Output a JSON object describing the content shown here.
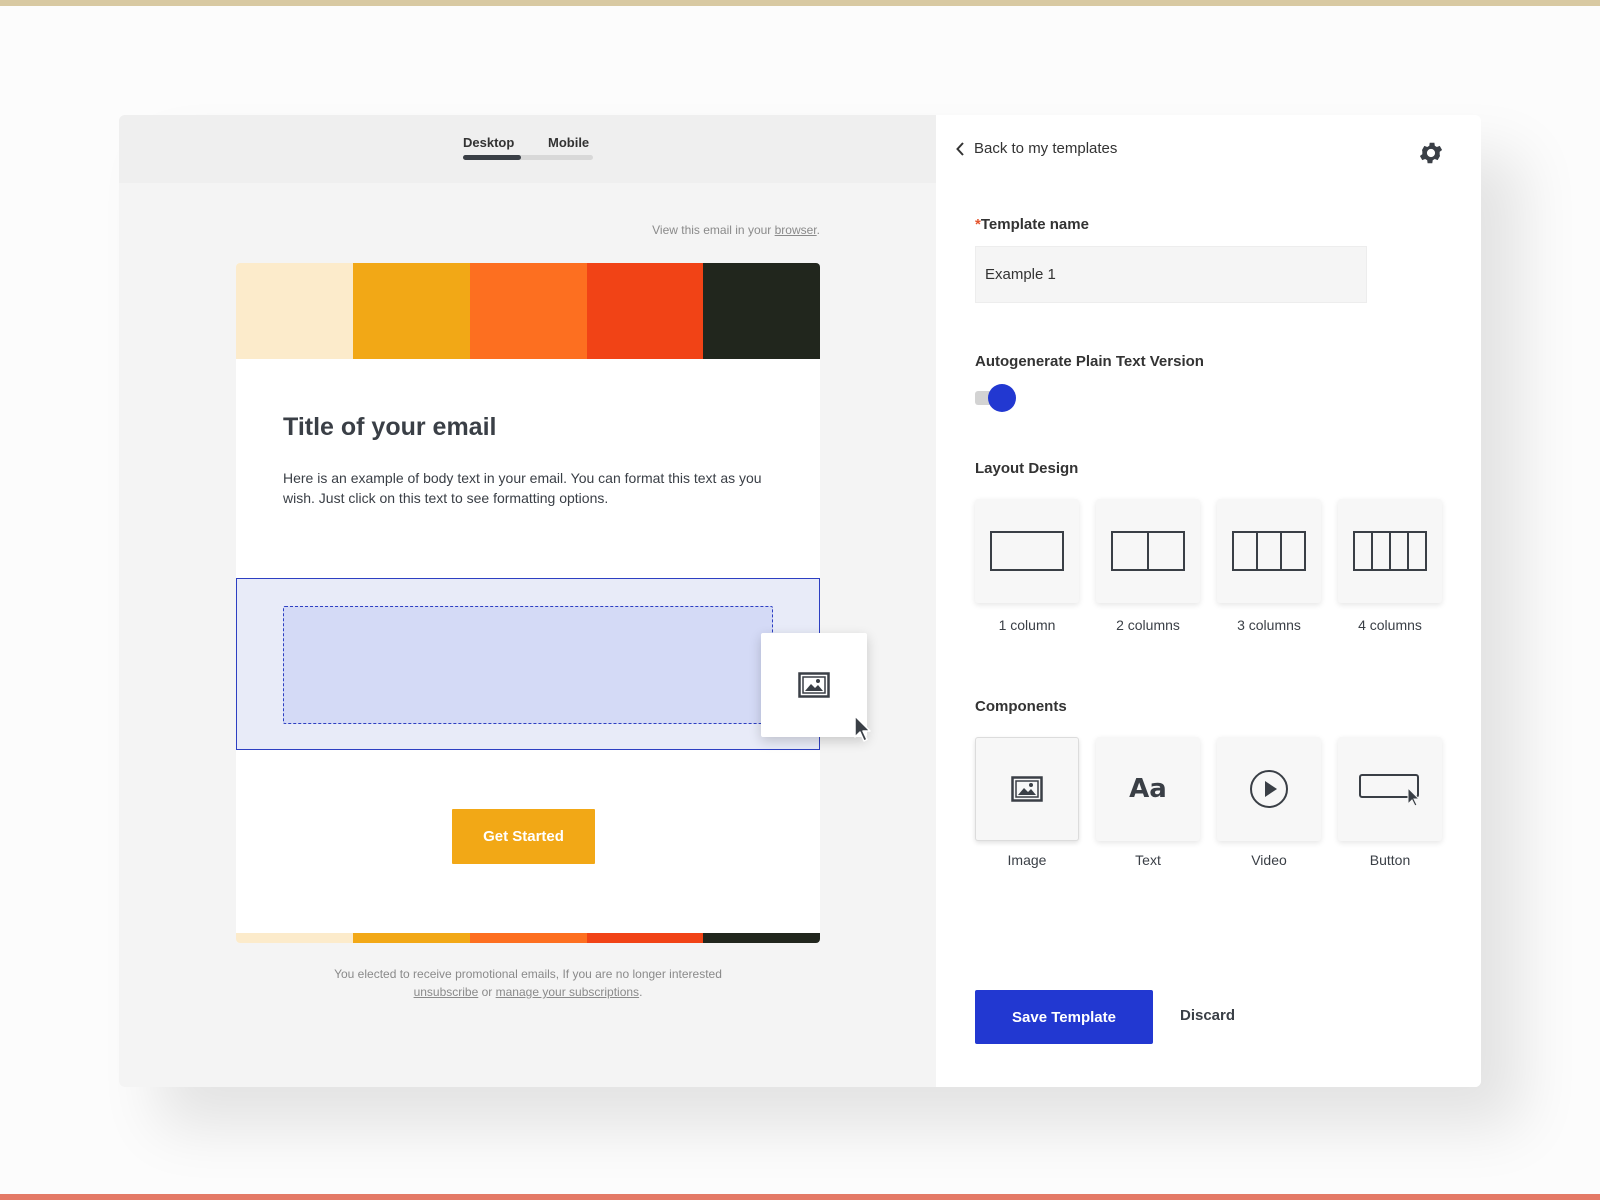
{
  "colors": {
    "top_strip": "#d8c9a2",
    "bottom_strip": "#e47966",
    "accent_blue": "#2238d1",
    "cta_orange": "#f2a816",
    "palette": [
      "#fcebcb",
      "#f2a816",
      "#fd6f20",
      "#f14316",
      "#21261d"
    ]
  },
  "preview": {
    "tabs": [
      {
        "label": "Desktop",
        "active": true
      },
      {
        "label": "Mobile",
        "active": false
      }
    ],
    "view_in_browser_prefix": "View this email in your ",
    "view_in_browser_link": "browser",
    "view_in_browser_suffix": ".",
    "email": {
      "title": "Title of your email",
      "body": "Here is an example of body text in your email. You can format this text as you wish. Just click on this text to see formatting options.",
      "cta_label": "Get Started",
      "dragging_component_icon": "image-icon"
    },
    "footer": {
      "line1": "You elected to receive promotional emails, If you are no longer interested",
      "unsubscribe": "unsubscribe",
      "or": " or ",
      "manage": "manage your subscriptions",
      "end": "."
    }
  },
  "panel": {
    "back_label": "Back to my templates",
    "settings_icon": "gear-icon",
    "template_name": {
      "required_mark": "*",
      "label": "Template name",
      "value": "Example 1"
    },
    "autogenerate": {
      "label": "Autogenerate Plain Text Version",
      "enabled": true
    },
    "layout": {
      "label": "Layout Design",
      "options": [
        {
          "label": "1 column",
          "columns": 1
        },
        {
          "label": "2 columns",
          "columns": 2
        },
        {
          "label": "3 columns",
          "columns": 3
        },
        {
          "label": "4 columns",
          "columns": 4
        }
      ]
    },
    "components": {
      "label": "Components",
      "items": [
        {
          "label": "Image",
          "icon": "image-icon"
        },
        {
          "label": "Text",
          "icon": "Aa"
        },
        {
          "label": "Video",
          "icon": "play-icon"
        },
        {
          "label": "Button",
          "icon": "button-icon"
        }
      ]
    },
    "save_label": "Save Template",
    "discard_label": "Discard"
  }
}
